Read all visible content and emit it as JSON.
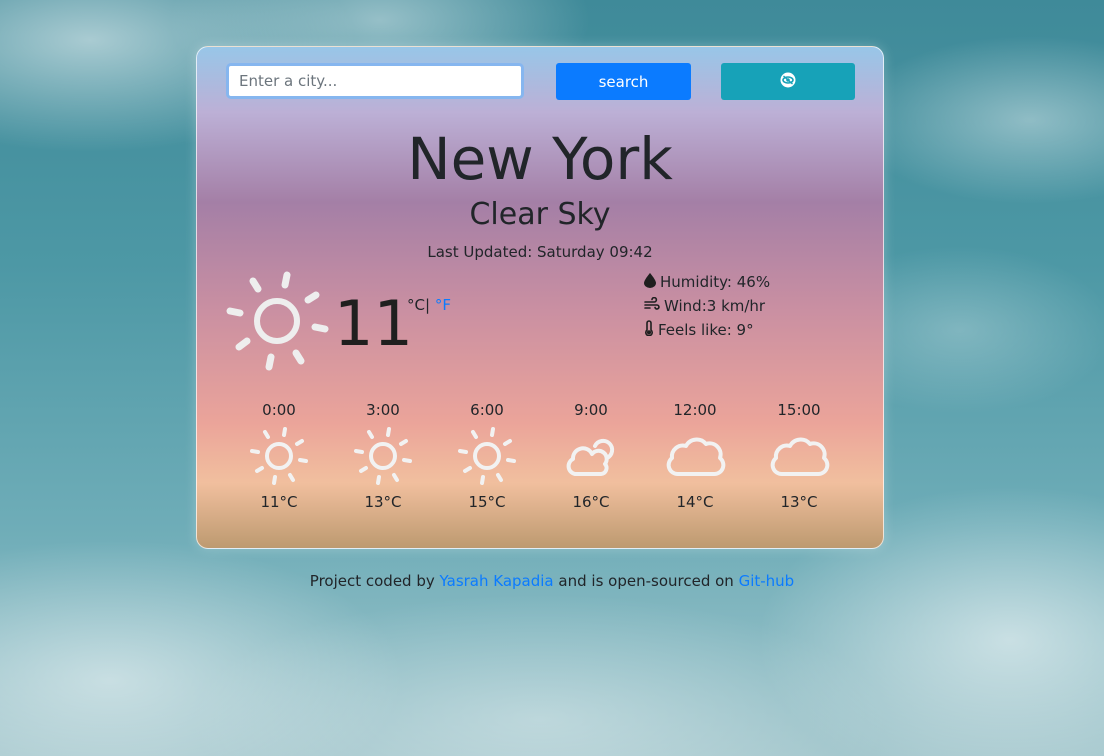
{
  "search": {
    "placeholder": "Enter a city...",
    "value": "",
    "button_label": "search",
    "location_icon": "location-eye-icon"
  },
  "weather": {
    "city": "New York",
    "description": "Clear Sky",
    "last_updated": "Last Updated: Saturday 09:42",
    "icon": "sun-icon",
    "temperature": "11",
    "unit_celsius": "°C|",
    "unit_fahrenheit": "°F",
    "humidity": "Humidity: 46%",
    "wind": "Wind:3 km/hr",
    "feels_like": "Feels like: 9°"
  },
  "forecast": [
    {
      "time": "0:00",
      "temp": "11°C",
      "icon": "sun-icon"
    },
    {
      "time": "3:00",
      "temp": "13°C",
      "icon": "sun-icon"
    },
    {
      "time": "6:00",
      "temp": "15°C",
      "icon": "sun-icon"
    },
    {
      "time": "9:00",
      "temp": "16°C",
      "icon": "cloud-sun-icon"
    },
    {
      "time": "12:00",
      "temp": "14°C",
      "icon": "cloud-icon"
    },
    {
      "time": "15:00",
      "temp": "13°C",
      "icon": "cloud-icon"
    }
  ],
  "footer": {
    "prefix": "Project coded by",
    "author": "Yasrah Kapadia",
    "middle": "and is open-sourced on",
    "repo": "Git-hub"
  },
  "colors": {
    "accent": "#0b7bff",
    "location_button": "#17a2b8"
  }
}
